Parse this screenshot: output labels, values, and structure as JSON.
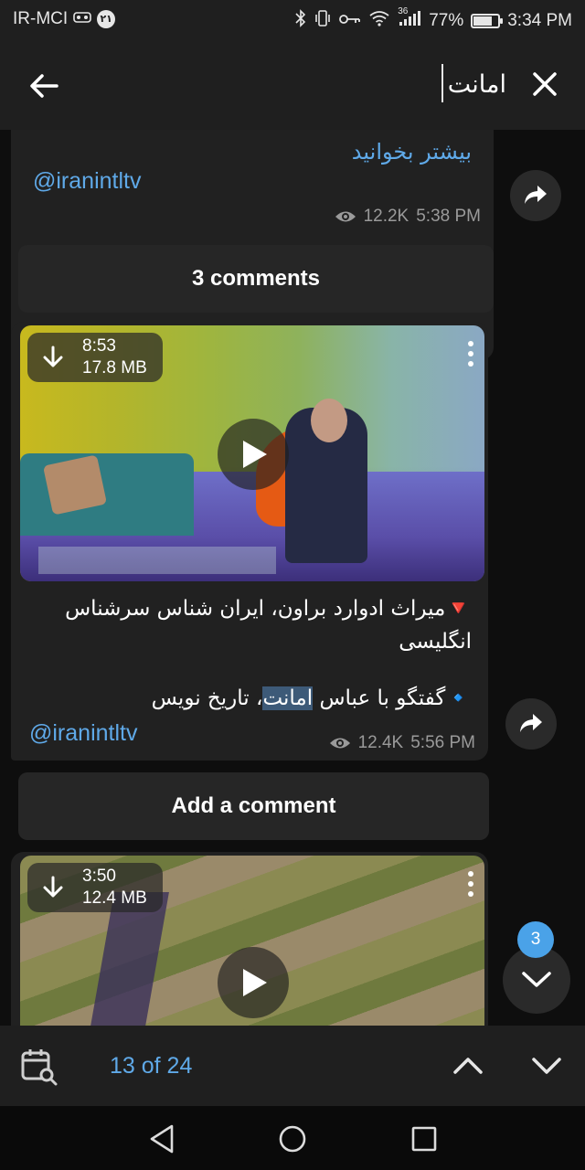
{
  "status_bar": {
    "carrier": "IR-MCI",
    "sim_badge": "۲۱",
    "network": "36",
    "battery": "77%",
    "battery_level": 0.77,
    "time": "3:34 PM"
  },
  "search": {
    "query": "امانت"
  },
  "messages": [
    {
      "read_more": "بیشتر بخوانید",
      "channel": "@iranintltv",
      "views": "12.2K",
      "time": "5:38 PM",
      "comments_label": "3 comments"
    },
    {
      "video_duration": "8:53",
      "video_size": "17.8 MB",
      "caption_line_1": "🔻میراث ادوارد براون، ایران شناس سرشناس",
      "caption_line_2": "انگلیسی",
      "caption_line_3_before": "🔹گفتگو با عباس ",
      "caption_line_3_highlight": "امانت",
      "caption_line_3_after": "، تاریخ نویس",
      "channel": "@iranintltv",
      "views": "12.4K",
      "time": "5:56 PM",
      "comments_label": "Add a comment"
    },
    {
      "video_duration": "3:50",
      "video_size": "12.4 MB"
    }
  ],
  "scroll_down": {
    "unread_count": "3"
  },
  "search_footer": {
    "counter": "13 of 24"
  },
  "icons": {
    "back": "arrow-left-icon",
    "close": "close-icon",
    "share": "share-arrow-icon",
    "download": "download-icon",
    "more": "more-vertical-icon",
    "play": "play-icon",
    "eye": "eye-icon",
    "calendar_search": "calendar-search-icon",
    "chevron_up": "chevron-up-icon",
    "chevron_down": "chevron-down-icon"
  },
  "colors": {
    "accent": "#5fa9e8",
    "badge": "#4aa2e8",
    "bubble": "#212121",
    "highlight": "#3d5a78"
  }
}
